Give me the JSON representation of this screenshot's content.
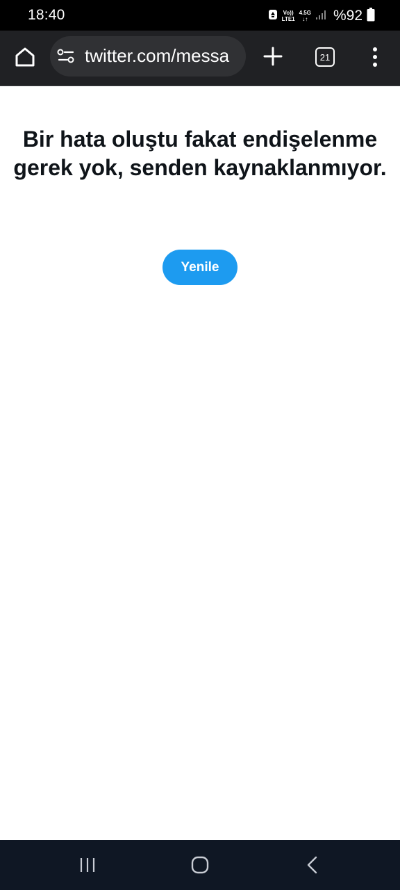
{
  "status_bar": {
    "time": "18:40",
    "volte_label": "Vo))",
    "lte_label": "LTE1",
    "network_type": "4.5G",
    "data_arrows": "↓↑",
    "battery_percent": "%92"
  },
  "browser": {
    "url": "twitter.com/messa",
    "tab_count": "21"
  },
  "page": {
    "error_message": "Bir hata oluştu fakat endişelenme gerek yok, senden kaynaklanmıyor.",
    "retry_label": "Yenile"
  },
  "colors": {
    "status_bg": "#000000",
    "toolbar_bg": "#202124",
    "omnibox_bg": "#303134",
    "accent": "#1d9bf0",
    "text": "#0f1419",
    "nav_bg": "#0f1724"
  }
}
